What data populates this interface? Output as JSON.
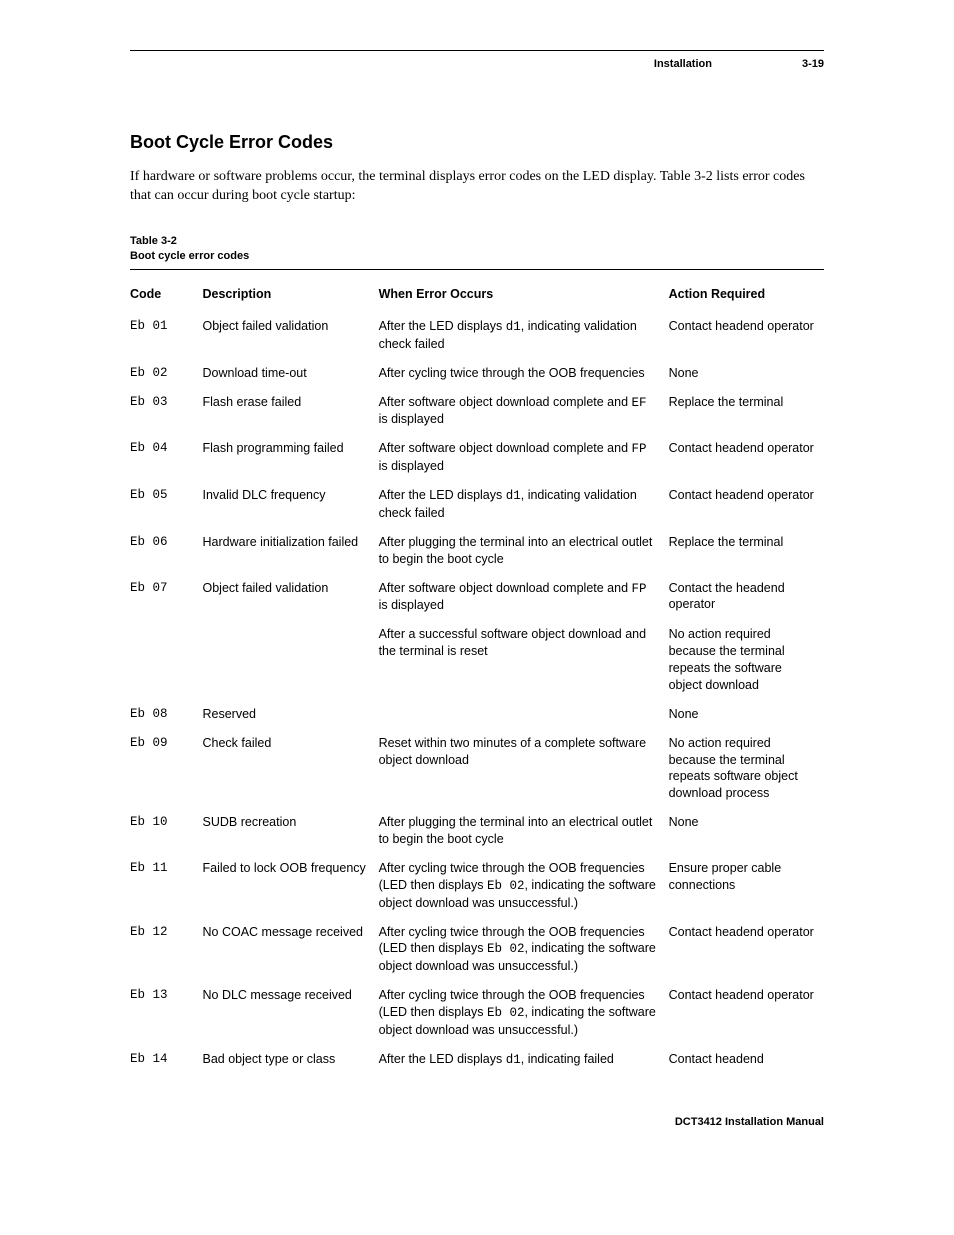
{
  "header": {
    "section": "Installation",
    "page": "3-19"
  },
  "title": "Boot Cycle Error Codes",
  "intro": "If hardware or software problems occur, the terminal displays error codes on the LED display. Table 3-2 lists error codes that can occur during boot cycle startup:",
  "table_label_line1": "Table 3-2",
  "table_label_line2": "Boot cycle error codes",
  "columns": {
    "code": "Code",
    "description": "Description",
    "when": "When Error Occurs",
    "action": "Action Required"
  },
  "rows": [
    {
      "code": "Eb 01",
      "description": "Object failed validation",
      "when": [
        {
          "t": "After the LED displays "
        },
        {
          "m": "d1"
        },
        {
          "t": ", indicating validation check failed"
        }
      ],
      "action": "Contact headend operator"
    },
    {
      "code": "Eb 02",
      "description": "Download time-out",
      "when": [
        {
          "t": "After cycling twice through the OOB frequencies"
        }
      ],
      "action": "None"
    },
    {
      "code": "Eb 03",
      "description": "Flash erase failed",
      "when": [
        {
          "t": "After software object download complete and "
        },
        {
          "m": "EF"
        },
        {
          "t": " is displayed"
        }
      ],
      "action": "Replace the terminal"
    },
    {
      "code": "Eb 04",
      "description": "Flash programming failed",
      "when": [
        {
          "t": "After software object download complete and "
        },
        {
          "m": "FP"
        },
        {
          "t": " is displayed"
        }
      ],
      "action": "Contact headend operator"
    },
    {
      "code": "Eb 05",
      "description": "Invalid DLC frequency",
      "when": [
        {
          "t": "After the LED displays "
        },
        {
          "m": "d1"
        },
        {
          "t": ", indicating validation check failed"
        }
      ],
      "action": "Contact headend operator"
    },
    {
      "code": "Eb 06",
      "description": "Hardware initialization failed",
      "when": [
        {
          "t": "After plugging the terminal into an electrical outlet to begin the boot cycle"
        }
      ],
      "action": "Replace the terminal"
    },
    {
      "code": "Eb 07",
      "description": "Object failed validation",
      "when": [
        {
          "t": "After software object download complete and "
        },
        {
          "m": "FP"
        },
        {
          "t": " is displayed"
        }
      ],
      "action": "Contact the headend operator"
    },
    {
      "code": "",
      "description": "",
      "when": [
        {
          "t": "After a successful software object download and the terminal is reset"
        }
      ],
      "action": "No action required because the terminal repeats the software object download"
    },
    {
      "code": "Eb 08",
      "description": "Reserved",
      "when": [],
      "action": "None"
    },
    {
      "code": "Eb 09",
      "description": "Check failed",
      "when": [
        {
          "t": "Reset within two minutes of a complete software object download"
        }
      ],
      "action": "No action required because the terminal repeats software object download process"
    },
    {
      "code": "Eb 10",
      "description": "SUDB recreation",
      "when": [
        {
          "t": "After plugging the terminal into an electrical outlet to begin the boot cycle"
        }
      ],
      "action": "None"
    },
    {
      "code": "Eb 11",
      "description": "Failed to lock OOB frequency",
      "when": [
        {
          "t": "After cycling twice through the OOB frequencies (LED then displays "
        },
        {
          "m": "Eb 02"
        },
        {
          "t": ", indicating the software object download was unsuccessful.)"
        }
      ],
      "action": "Ensure proper cable connections"
    },
    {
      "code": "Eb 12",
      "description": "No COAC message received",
      "when": [
        {
          "t": "After cycling twice through the OOB frequencies (LED then displays "
        },
        {
          "m": "Eb 02"
        },
        {
          "t": ", indicating the software object download was unsuccessful.)"
        }
      ],
      "action": "Contact headend operator"
    },
    {
      "code": "Eb 13",
      "description": "No DLC message received",
      "when": [
        {
          "t": "After cycling twice through the OOB frequencies (LED then displays "
        },
        {
          "m": "Eb 02"
        },
        {
          "t": ", indicating the software object download was unsuccessful.)"
        }
      ],
      "action": "Contact headend operator"
    },
    {
      "code": "Eb 14",
      "description": "Bad object type or class",
      "when": [
        {
          "t": "After the LED displays "
        },
        {
          "m": "d1"
        },
        {
          "t": ", indicating failed"
        }
      ],
      "action": "Contact headend"
    }
  ],
  "footer": "DCT3412 Installation Manual"
}
